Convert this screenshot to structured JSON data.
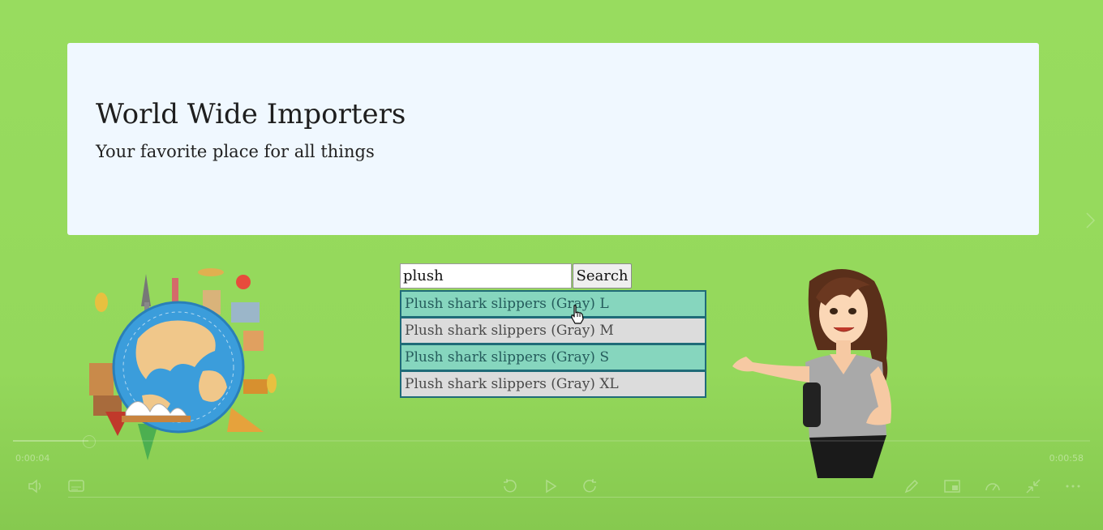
{
  "header": {
    "title": "World Wide Importers",
    "tagline": "Your favorite place for all things"
  },
  "search": {
    "value": "plush",
    "button_label": "Search"
  },
  "suggestions": [
    {
      "label": "Plush shark slippers (Gray) L",
      "highlight": true
    },
    {
      "label": "Plush shark slippers (Gray) M",
      "highlight": false
    },
    {
      "label": "Plush shark slippers (Gray) S",
      "highlight": true
    },
    {
      "label": "Plush shark slippers (Gray) XL",
      "highlight": false
    }
  ],
  "player": {
    "elapsed": "0:00:04",
    "duration": "0:00:58",
    "progress": 0.07
  },
  "icons": [
    "volume-icon",
    "captions-icon",
    "rewind-10-icon",
    "play-icon",
    "forward-10-icon",
    "pen-icon",
    "pip-icon",
    "speed-icon",
    "minimize-icon",
    "more-icon",
    "next-slide-icon",
    "hand-cursor-icon"
  ],
  "colors": {
    "background": "#98dc5f",
    "card": "#f0f8ff",
    "suggestion_highlight": "#86d6be",
    "suggestion_plain": "#dcdcdc",
    "suggestion_border": "#1f6b78"
  }
}
